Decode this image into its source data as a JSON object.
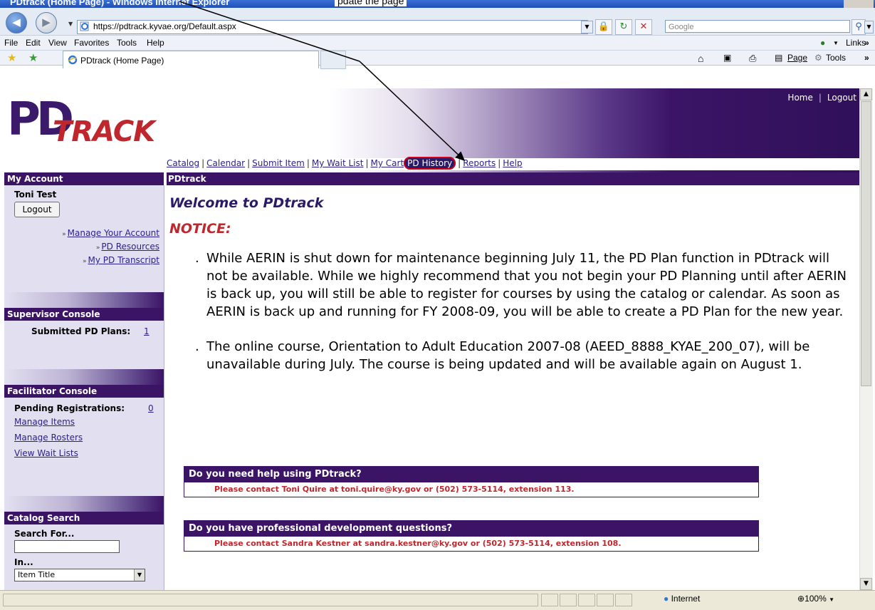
{
  "browser": {
    "window_title": "PDtrack (Home Page) - Windows Internet Explorer",
    "annotation_text": "pdate the page",
    "address_url": "https://pdtrack.kyvae.org/Default.aspx",
    "search_placeholder": "Google",
    "menu": [
      "File",
      "Edit",
      "View",
      "Favorites",
      "Tools",
      "Help"
    ],
    "links_label": "Links",
    "tab_label": "PDtrack (Home Page)",
    "toolbar_page": "Page",
    "toolbar_tools": "Tools",
    "status_zone": "Internet",
    "zoom": "100%"
  },
  "site": {
    "logo_pd": "PD",
    "logo_track": "TRACK",
    "top_links": [
      "Home",
      "Logout"
    ],
    "nav": [
      "Catalog",
      "Calendar",
      "Submit Item",
      "My Wait List",
      "My Cart",
      "PD History",
      "Reports",
      "Help"
    ],
    "highlighted_nav": "PD History",
    "sidebar_header": "My Account",
    "content_header": "PDtrack"
  },
  "sidebar": {
    "user_name": "Toni Test",
    "logout_button": "Logout",
    "account_links": [
      "Manage Your Account",
      "PD Resources",
      "My PD Transcript"
    ],
    "supervisor": {
      "header": "Supervisor Console",
      "label": "Submitted PD Plans:",
      "count": "1"
    },
    "facilitator": {
      "header": "Facilitator Console",
      "label": "Pending Registrations:",
      "count": "0",
      "links": [
        "Manage Items",
        "Manage Rosters",
        "View Wait Lists"
      ]
    },
    "catalog_search": {
      "header": "Catalog Search",
      "search_label": "Search For...",
      "search_value": "",
      "in_label": "In...",
      "in_value": "Item Title"
    }
  },
  "main": {
    "welcome": "Welcome to PDtrack",
    "notice": "NOTICE:",
    "bullets": [
      "While AERIN is shut down for maintenance beginning July 11, the PD Plan function in PDtrack will not be available. While we highly recommend that you not begin your PD Planning until after AERIN is back up, you will still be able to register for courses by using the catalog or calendar. As soon as AERIN is back up and running for FY 2008-09, you will be able to create a PD Plan for the new year.",
      "The online course, Orientation to Adult Education 2007-08 (AEED_8888_KYAE_200_07), will be unavailable during July. The course is being updated and will be available again on August 1."
    ],
    "help_boxes": [
      {
        "title": "Do you need help using PDtrack?",
        "body": "Please contact Toni Quire at toni.quire@ky.gov or (502) 573-5114, extension 113."
      },
      {
        "title": "Do you have professional development questions?",
        "body": "Please contact Sandra Kestner at sandra.kestner@ky.gov or (502) 573-5114, extension 108."
      }
    ]
  },
  "colors": {
    "brand_purple": "#3b1466",
    "brand_red": "#c0272d",
    "link_blue": "#2a1f8a",
    "sidebar_bg": "#e2e0f0"
  }
}
